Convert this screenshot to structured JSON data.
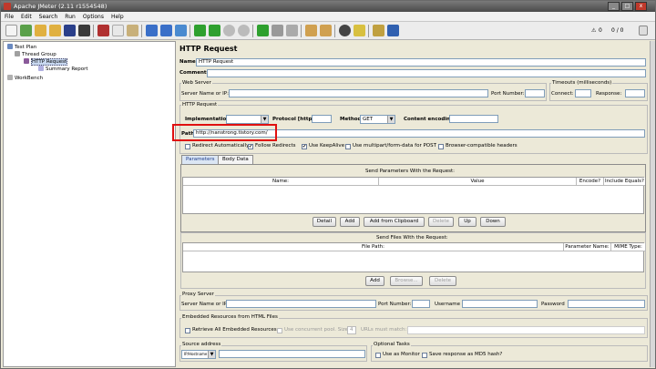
{
  "window": {
    "title": "Apache JMeter (2.11 r1554548)",
    "min": "_",
    "max": "□",
    "close": "x"
  },
  "menu": [
    "File",
    "Edit",
    "Search",
    "Run",
    "Options",
    "Help"
  ],
  "toolbar": {
    "warnings": "0",
    "threads": "0 / 0"
  },
  "tree": {
    "test_plan": "Test Plan",
    "thread_group": "Thread Group",
    "http_request": "HTTP Request",
    "summary_report": "Summary Report",
    "workbench": "WorkBench"
  },
  "panel": {
    "title": "HTTP Request",
    "name_label": "Name:",
    "name_value": "HTTP Request",
    "comments_label": "Comments:",
    "web_server": {
      "title": "Web Server",
      "server_label": "Server Name or IP:",
      "port_label": "Port Number:"
    },
    "timeouts": {
      "title": "Timeouts (milliseconds)",
      "connect_label": "Connect:",
      "response_label": "Response:"
    },
    "http_request": {
      "title": "HTTP Request",
      "implementation_label": "Implementation:",
      "protocol_label": "Protocol [http]:",
      "method_label": "Method:",
      "method_value": "GET",
      "encoding_label": "Content encoding:",
      "path_label": "Path:",
      "path_value": "http://nanstrong.tistory.com/"
    },
    "options": {
      "redirect_auto": "Redirect Automatically",
      "follow_redirects": "Follow Redirects",
      "keepalive": "Use KeepAlive",
      "multipart": "Use multipart/form-data for POST",
      "browser_headers": "Browser-compatible headers"
    },
    "tabs": {
      "parameters": "Parameters",
      "body": "Body Data"
    },
    "params": {
      "title": "Send Parameters With the Request:",
      "col_name": "Name:",
      "col_value": "Value",
      "col_encode": "Encode?",
      "col_include": "Include Equals?"
    },
    "param_buttons": {
      "detail": "Detail",
      "add": "Add",
      "add_clipboard": "Add from Clipboard",
      "delete": "Delete",
      "up": "Up",
      "down": "Down"
    },
    "files": {
      "title": "Send Files With the Request:",
      "col_path": "File Path:",
      "col_param": "Parameter Name:",
      "col_mime": "MIME Type:"
    },
    "file_buttons": {
      "add": "Add",
      "browse": "Browse...",
      "delete": "Delete"
    },
    "proxy": {
      "title": "Proxy Server",
      "server_label": "Server Name or IP:",
      "port_label": "Port Number:",
      "user_label": "Username",
      "pass_label": "Password"
    },
    "embedded": {
      "title": "Embedded Resources from HTML Files",
      "retrieve": "Retrieve All Embedded Resources",
      "pool": "Use concurrent pool. Size:",
      "pool_size": "4",
      "urls_label": "URLs must match:"
    },
    "source": {
      "title": "Source address",
      "type": "IP/Hostname"
    },
    "optional": {
      "title": "Optional Tasks",
      "monitor": "Use as Monitor",
      "md5": "Save response as MD5 hash?"
    }
  }
}
